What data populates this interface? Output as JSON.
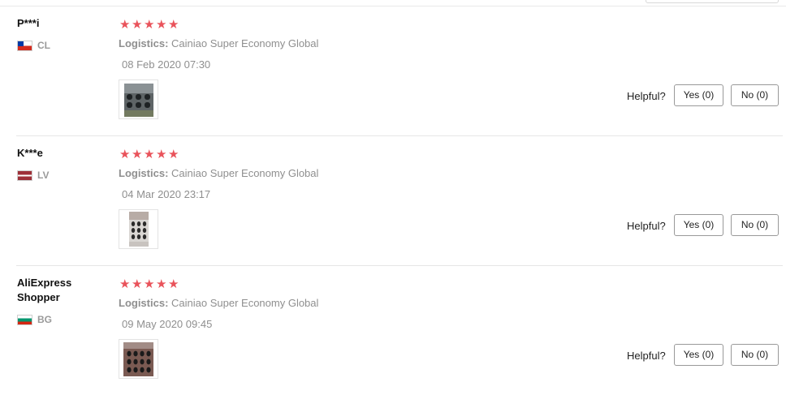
{
  "labels": {
    "logistics": "Logistics:",
    "helpful": "Helpful?"
  },
  "reviews": [
    {
      "user": "P***i",
      "country": "CL",
      "flag_icon": "chile-flag-icon",
      "rating": 5,
      "stars": [
        "★",
        "★",
        "★",
        "★",
        "★"
      ],
      "logistics": "Cainiao Super Economy Global",
      "date": "08 Feb 2020 07:30",
      "yes": "Yes (0)",
      "no": "No (0)"
    },
    {
      "user": "K***e",
      "country": "LV",
      "flag_icon": "latvia-flag-icon",
      "rating": 5,
      "stars": [
        "★",
        "★",
        "★",
        "★",
        "★"
      ],
      "logistics": "Cainiao Super Economy Global",
      "date": "04 Mar 2020 23:17",
      "yes": "Yes (0)",
      "no": "No (0)"
    },
    {
      "user": "AliExpress Shopper",
      "country": "BG",
      "flag_icon": "bulgaria-flag-icon",
      "rating": 5,
      "stars": [
        "★",
        "★",
        "★",
        "★",
        "★"
      ],
      "logistics": "Cainiao Super Economy Global",
      "date": "09 May 2020 09:45",
      "yes": "Yes (0)",
      "no": "No (0)"
    }
  ],
  "colors": {
    "star": "#e9535b",
    "muted_text": "#8f8f8f",
    "divider": "#e6e6e6"
  }
}
